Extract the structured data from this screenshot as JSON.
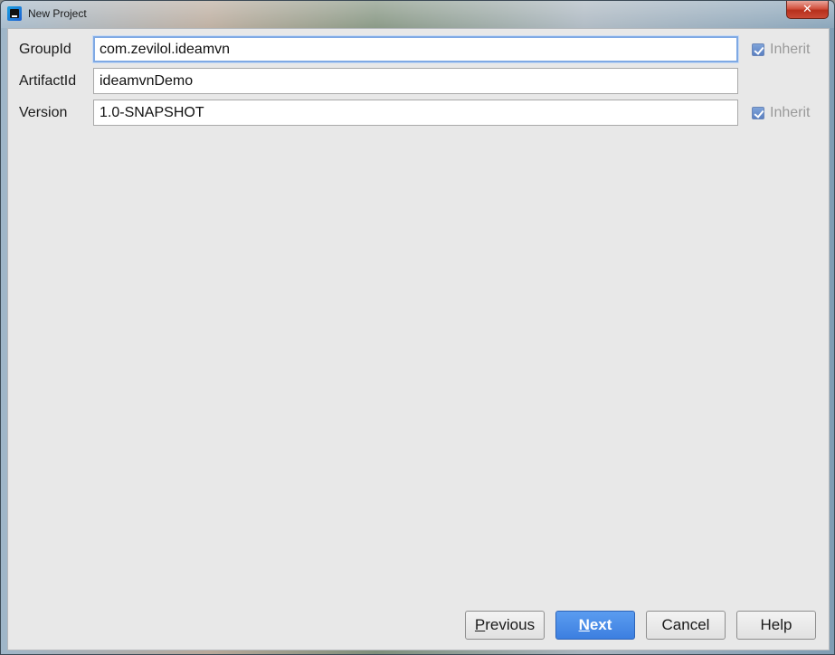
{
  "window": {
    "title": "New Project",
    "close_glyph": "✕"
  },
  "form": {
    "fields": [
      {
        "label": "GroupId",
        "value": "com.zevilol.ideamvn",
        "inherit": true,
        "inherit_label": "Inherit"
      },
      {
        "label": "ArtifactId",
        "value": "ideamvnDemo"
      },
      {
        "label": "Version",
        "value": "1.0-SNAPSHOT",
        "inherit": true,
        "inherit_label": "Inherit"
      }
    ]
  },
  "buttons": {
    "previous": {
      "mnemonic": "P",
      "rest": "revious"
    },
    "next": {
      "mnemonic": "N",
      "rest": "ext"
    },
    "cancel": "Cancel",
    "help": "Help"
  },
  "colors": {
    "primary_button": "#3c7fe0",
    "focus_border": "#7fa9e4",
    "inherit_text": "#9a9a9a"
  },
  "icons": {
    "app": "intellij-idea-icon",
    "close": "close-icon",
    "checkbox": "checkbox-checked-icon"
  }
}
